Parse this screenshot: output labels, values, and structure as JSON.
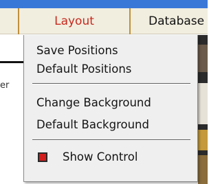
{
  "menubar": {
    "items": [
      {
        "label": "Layout",
        "active": true
      },
      {
        "label": "Database"
      }
    ]
  },
  "background": {
    "left_text_fragment": "er"
  },
  "dropdown": {
    "items": [
      {
        "label": "Save Positions"
      },
      {
        "label": "Default Positions"
      },
      {
        "label": "Change Background"
      },
      {
        "label": "Default Background"
      },
      {
        "label": "Show Control",
        "icon": "red-square-checkbox-icon",
        "checked": true
      }
    ]
  },
  "colors": {
    "active_menu_text": "#c8281e",
    "menubar_bg": "#f1eedf",
    "dropdown_bg": "#efefef",
    "check_icon": "#d31d1d",
    "top_strip": "#3a78d8"
  }
}
